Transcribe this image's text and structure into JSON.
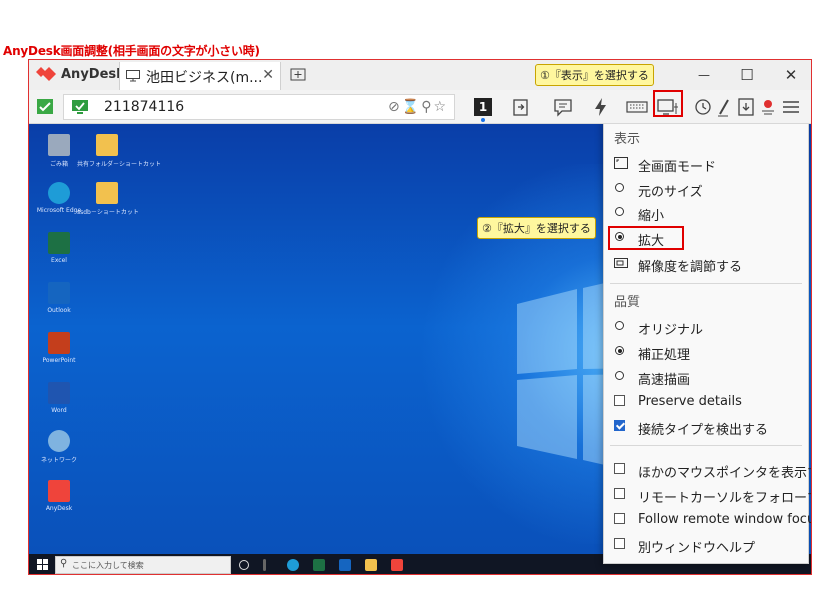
{
  "page_title": "AnyDesk画面調整(相手画面の文字が小さい時)",
  "window": {
    "app_name": "AnyDesk",
    "tab_label": "池田ビジネス(m...",
    "tab_close": "✕",
    "new_tab": "+",
    "minimize": "—",
    "maximize": "☐",
    "close": "✕"
  },
  "callouts": {
    "display": "①『表示』を選択する",
    "zoom": "②『拡大』を選択する"
  },
  "toolbar": {
    "address": "211874116",
    "address_icons": "⊘⌛⚲☆",
    "monitor_number": "1"
  },
  "desktop": {
    "icons": [
      {
        "caption": "ごみ箱",
        "color": "#9aa9bd"
      },
      {
        "caption": "共有フォルダ－ショートカット",
        "color": "#f2c14e"
      },
      {
        "caption": "Microsoft Edge",
        "color": "#1e9cd7"
      },
      {
        "caption": "ssdb－ショートカット",
        "color": "#f2c14e"
      },
      {
        "caption": "Excel",
        "color": "#1d7044"
      },
      {
        "caption": "Outlook",
        "color": "#1565c0"
      },
      {
        "caption": "PowerPoint",
        "color": "#c43e1c"
      },
      {
        "caption": "Word",
        "color": "#1f55b0"
      },
      {
        "caption": "ネットワーク",
        "color": "#7fb3e0"
      },
      {
        "caption": "AnyDesk",
        "color": "#ef443b"
      }
    ],
    "taskbar_search": "ここに入力して検索",
    "search_icon": "⚲"
  },
  "menu": {
    "display_header": "表示",
    "display_items": [
      {
        "label": "全画面モード",
        "type": "icon"
      },
      {
        "label": "元のサイズ",
        "type": "radio",
        "checked": false
      },
      {
        "label": "縮小",
        "type": "radio",
        "checked": false
      },
      {
        "label": "拡大",
        "type": "radio",
        "checked": true
      },
      {
        "label": "解像度を調節する",
        "type": "icon"
      }
    ],
    "quality_header": "品質",
    "quality_items": [
      {
        "label": "オリジナル",
        "type": "radio",
        "checked": false
      },
      {
        "label": "補正処理",
        "type": "radio",
        "checked": true
      },
      {
        "label": "高速描画",
        "type": "radio",
        "checked": false
      },
      {
        "label": "Preserve details",
        "type": "check",
        "checked": false
      },
      {
        "label": "接続タイプを検出する",
        "type": "check",
        "checked": true
      }
    ],
    "other_items": [
      {
        "label": "ほかのマウスポインタを表示する",
        "type": "check",
        "checked": false
      },
      {
        "label": "リモートカーソルをフォローする",
        "type": "check",
        "checked": false
      },
      {
        "label": "Follow remote window focus",
        "type": "check",
        "checked": false
      },
      {
        "label": "別ウィンドウヘルプ",
        "type": "check",
        "checked": false
      }
    ]
  },
  "colors": {
    "accent_red": "#e00000",
    "anydesk_red": "#ef443b",
    "callout_bg": "#fff79e"
  }
}
